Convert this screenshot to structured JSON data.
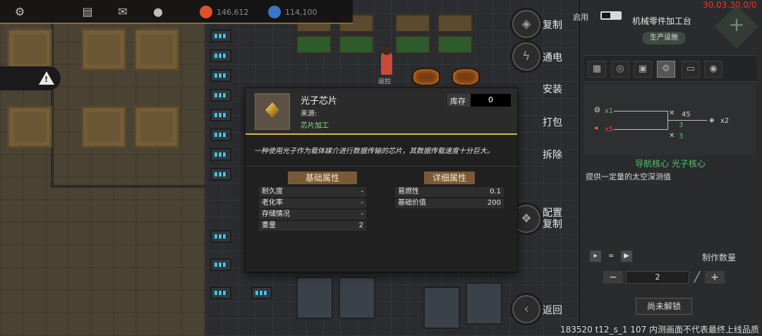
{
  "hud": {
    "icons": [
      "gear-icon",
      "keyboard-icon",
      "mail-icon",
      "user-icon"
    ],
    "resources": [
      {
        "icon": "food-icon",
        "color": "#e0502a",
        "value": "146,612"
      },
      {
        "icon": "population-icon",
        "color": "#3a76c4",
        "value": "114,100"
      }
    ]
  },
  "world": {
    "character_label": "运拉"
  },
  "actions": [
    {
      "id": "copy",
      "label": "复制",
      "icon": "copy-icon"
    },
    {
      "id": "power",
      "label": "通电",
      "icon": "lightning-icon"
    },
    {
      "id": "install",
      "label": "安装",
      "icon": "wrench-icon"
    },
    {
      "id": "pack",
      "label": "打包",
      "icon": "box-icon"
    },
    {
      "id": "dismantle",
      "label": "拆除",
      "icon": "hammer-icon"
    },
    {
      "id": "config-copy",
      "label": "配置\n复制",
      "icon": "config-icon"
    },
    {
      "id": "back",
      "label": "返回",
      "icon": "back-icon"
    }
  ],
  "panel": {
    "enable_label": "启用",
    "version": "30.03.30.0/0",
    "station_title": "机械零件加工台",
    "category_tag": "生产设施",
    "tabs": [
      "grid-icon",
      "drum-icon",
      "crate-icon",
      "gear-tab-icon",
      "screen-icon",
      "disk-icon"
    ],
    "active_tab": 3,
    "recipe": {
      "inputs": [
        {
          "qty": "x1",
          "color": "#4fc36b"
        },
        {
          "qty": "x5",
          "color": "#e04040"
        }
      ],
      "time": "45",
      "tool_count_a": "3",
      "tool_count_b": "3",
      "output_qty": "x2",
      "name": "导航核心 光子核心",
      "description": "提供一定量的太空深测值"
    },
    "craft_count_label": "制作数量",
    "quantity": "2",
    "minus": "−",
    "plus": "+",
    "locked_button": "尚未解锁"
  },
  "popup": {
    "item_name": "光子芯片",
    "source_label": "来源:",
    "source_value": "芯片加工",
    "stock_label": "库存",
    "stock_value": "0",
    "description": "一种使用光子作为载体媒介进行数据传输的芯片，其数据传载速度十分巨大。",
    "basic_title": "基础属性",
    "detail_title": "详细属性",
    "basic_attrs": [
      {
        "key": "耐久度",
        "value": "-"
      },
      {
        "key": "老化率",
        "value": "-"
      },
      {
        "key": "存储情况",
        "value": "-"
      },
      {
        "key": "重量",
        "value": "2"
      }
    ],
    "detail_attrs": [
      {
        "key": "易燃性",
        "value": "0.1"
      },
      {
        "key": "基础价值",
        "value": "200"
      }
    ]
  },
  "status_line": "183520 t12_s_1 107  内测画面不代表最终上线品质"
}
